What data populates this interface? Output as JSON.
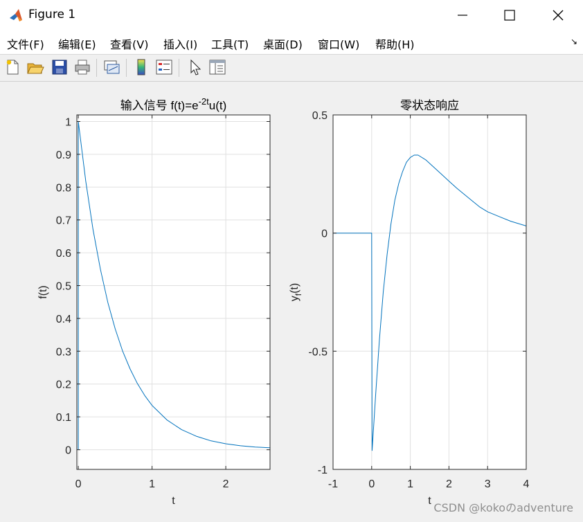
{
  "window": {
    "title": "Figure 1",
    "controls": [
      "minimize",
      "maximize",
      "close"
    ]
  },
  "menu": [
    "文件(F)",
    "编辑(E)",
    "查看(V)",
    "插入(I)",
    "工具(T)",
    "桌面(D)",
    "窗口(W)",
    "帮助(H)"
  ],
  "toolbar": {
    "buttons": [
      "new-figure-icon",
      "open-file-icon",
      "save-icon",
      "print-icon",
      "link-plot-icon",
      "colorbar-icon",
      "legend-icon",
      "pointer-icon",
      "property-editor-icon"
    ]
  },
  "colors": {
    "line": "#0072bd",
    "grid": "#e0e0e0",
    "figure_bg": "#f0f0f0",
    "axes_bg": "#ffffff"
  },
  "chart_data": [
    {
      "type": "line",
      "title_prefix": "输入信号 f(t)=e",
      "title_sup": "-2t",
      "title_suffix": "u(t)",
      "xlabel": "t",
      "ylabel": "f(t)",
      "xlim": [
        -0.02,
        2.6
      ],
      "ylim": [
        -0.06,
        1.02
      ],
      "xticks": [
        0,
        1,
        2
      ],
      "yticks": [
        0,
        0.1,
        0.2,
        0.3,
        0.4,
        0.5,
        0.6,
        0.7,
        0.8,
        0.9,
        1
      ],
      "ytick_labels": [
        "0",
        "0.1",
        "0.2",
        "0.3",
        "0.4",
        "0.5",
        "0.6",
        "0.7",
        "0.8",
        "0.9",
        "1"
      ],
      "grid": true,
      "series": [
        {
          "x": [
            0,
            0,
            0.1,
            0.2,
            0.3,
            0.4,
            0.5,
            0.6,
            0.7,
            0.8,
            0.9,
            1.0,
            1.2,
            1.4,
            1.6,
            1.8,
            2.0,
            2.2,
            2.4,
            2.6
          ],
          "y": [
            0,
            1,
            0.819,
            0.67,
            0.549,
            0.449,
            0.368,
            0.301,
            0.247,
            0.202,
            0.165,
            0.135,
            0.091,
            0.061,
            0.041,
            0.027,
            0.018,
            0.012,
            0.008,
            0.006
          ]
        }
      ]
    },
    {
      "type": "line",
      "title": "零状态响应",
      "xlabel": "t",
      "ylabel_main": "y",
      "ylabel_sub": "f",
      "ylabel_tail": "(t)",
      "xlim": [
        -1,
        4
      ],
      "ylim": [
        -1,
        0.5
      ],
      "xticks": [
        -1,
        0,
        1,
        2,
        3,
        4
      ],
      "yticks": [
        -1,
        -0.5,
        0,
        0.5
      ],
      "ytick_labels": [
        "-1",
        "-0.5",
        "0",
        "0.5"
      ],
      "grid": true,
      "series": [
        {
          "x": [
            -1,
            0,
            0.01,
            0.05,
            0.1,
            0.2,
            0.3,
            0.4,
            0.5,
            0.6,
            0.7,
            0.8,
            0.9,
            1.0,
            1.1,
            1.2,
            1.4,
            1.6,
            1.8,
            2.0,
            2.2,
            2.5,
            2.8,
            3.0,
            3.3,
            3.6,
            4.0
          ],
          "y": [
            0,
            0,
            -0.92,
            -0.82,
            -0.69,
            -0.45,
            -0.25,
            -0.09,
            0.04,
            0.14,
            0.21,
            0.26,
            0.3,
            0.32,
            0.33,
            0.33,
            0.31,
            0.28,
            0.25,
            0.22,
            0.19,
            0.15,
            0.11,
            0.09,
            0.07,
            0.05,
            0.03
          ]
        }
      ]
    }
  ],
  "watermark": "CSDN @kokoのadventure"
}
